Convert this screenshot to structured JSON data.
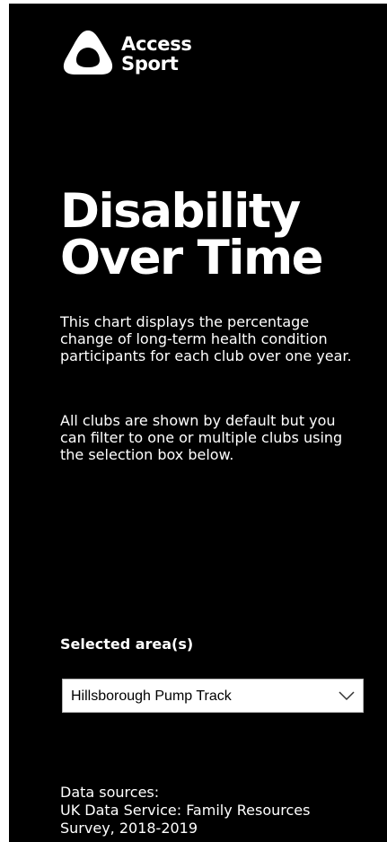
{
  "brand": {
    "name_line1": "Access",
    "name_line2": "Sport"
  },
  "header": {
    "title_line1": "Disability",
    "title_line2": "Over Time"
  },
  "description": {
    "paragraph1": "This chart displays the percentage change of long-term health condition participants for each club over one year.",
    "paragraph2": "All clubs are shown by default but you can filter to one or multiple clubs using the selection box below."
  },
  "filter": {
    "label": "Selected area(s)",
    "selected_value": "Hillsborough Pump Track"
  },
  "footer": {
    "sources_heading": "Data sources:",
    "sources_line1": "UK Data Service: Family Resources",
    "sources_line2": "Survey, 2018-2019"
  },
  "colors": {
    "panel_background": "#000000",
    "text": "#ffffff",
    "select_background": "#ffffff"
  },
  "icons": {
    "logo": "access-sport-logo-icon",
    "dropdown": "chevron-down-icon"
  }
}
